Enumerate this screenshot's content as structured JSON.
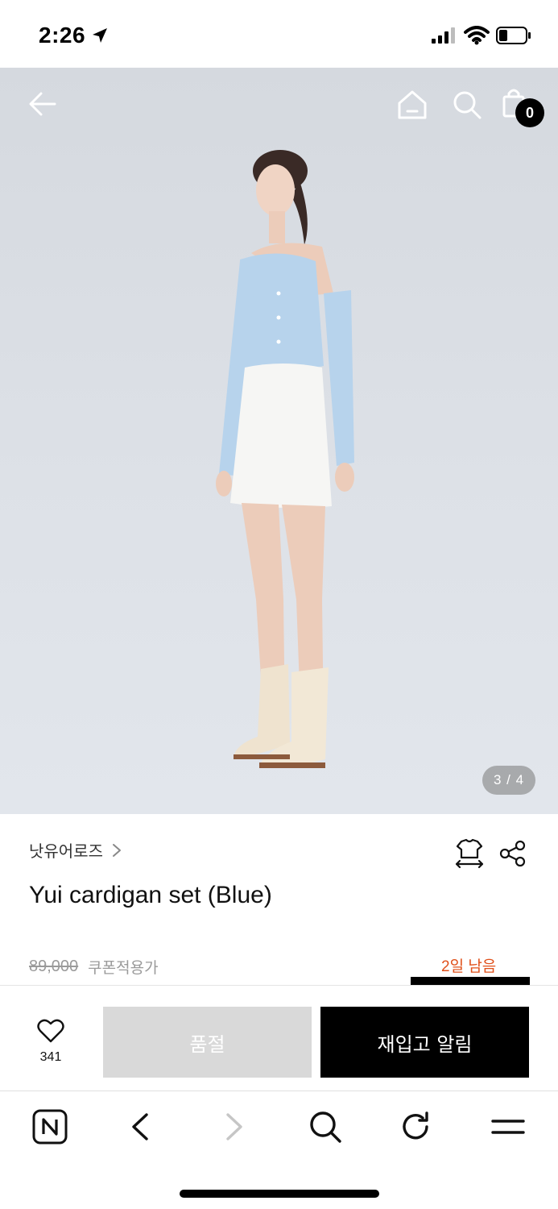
{
  "status_bar": {
    "time": "2:26"
  },
  "header": {
    "cart_count": "0"
  },
  "gallery": {
    "indicator": "3 / 4"
  },
  "product": {
    "brand": "낫유어로즈",
    "title": "Yui cardigan set (Blue)",
    "original_price": "89,000",
    "coupon_label": "쿠폰적용가",
    "days_left": "2일 남음"
  },
  "actions": {
    "like_count": "341",
    "soldout_label": "품절",
    "restock_label": "재입고 알림"
  },
  "colors": {
    "accent": "#e0501a",
    "primary_button": "#000000",
    "disabled_button": "#d9d9d9"
  }
}
